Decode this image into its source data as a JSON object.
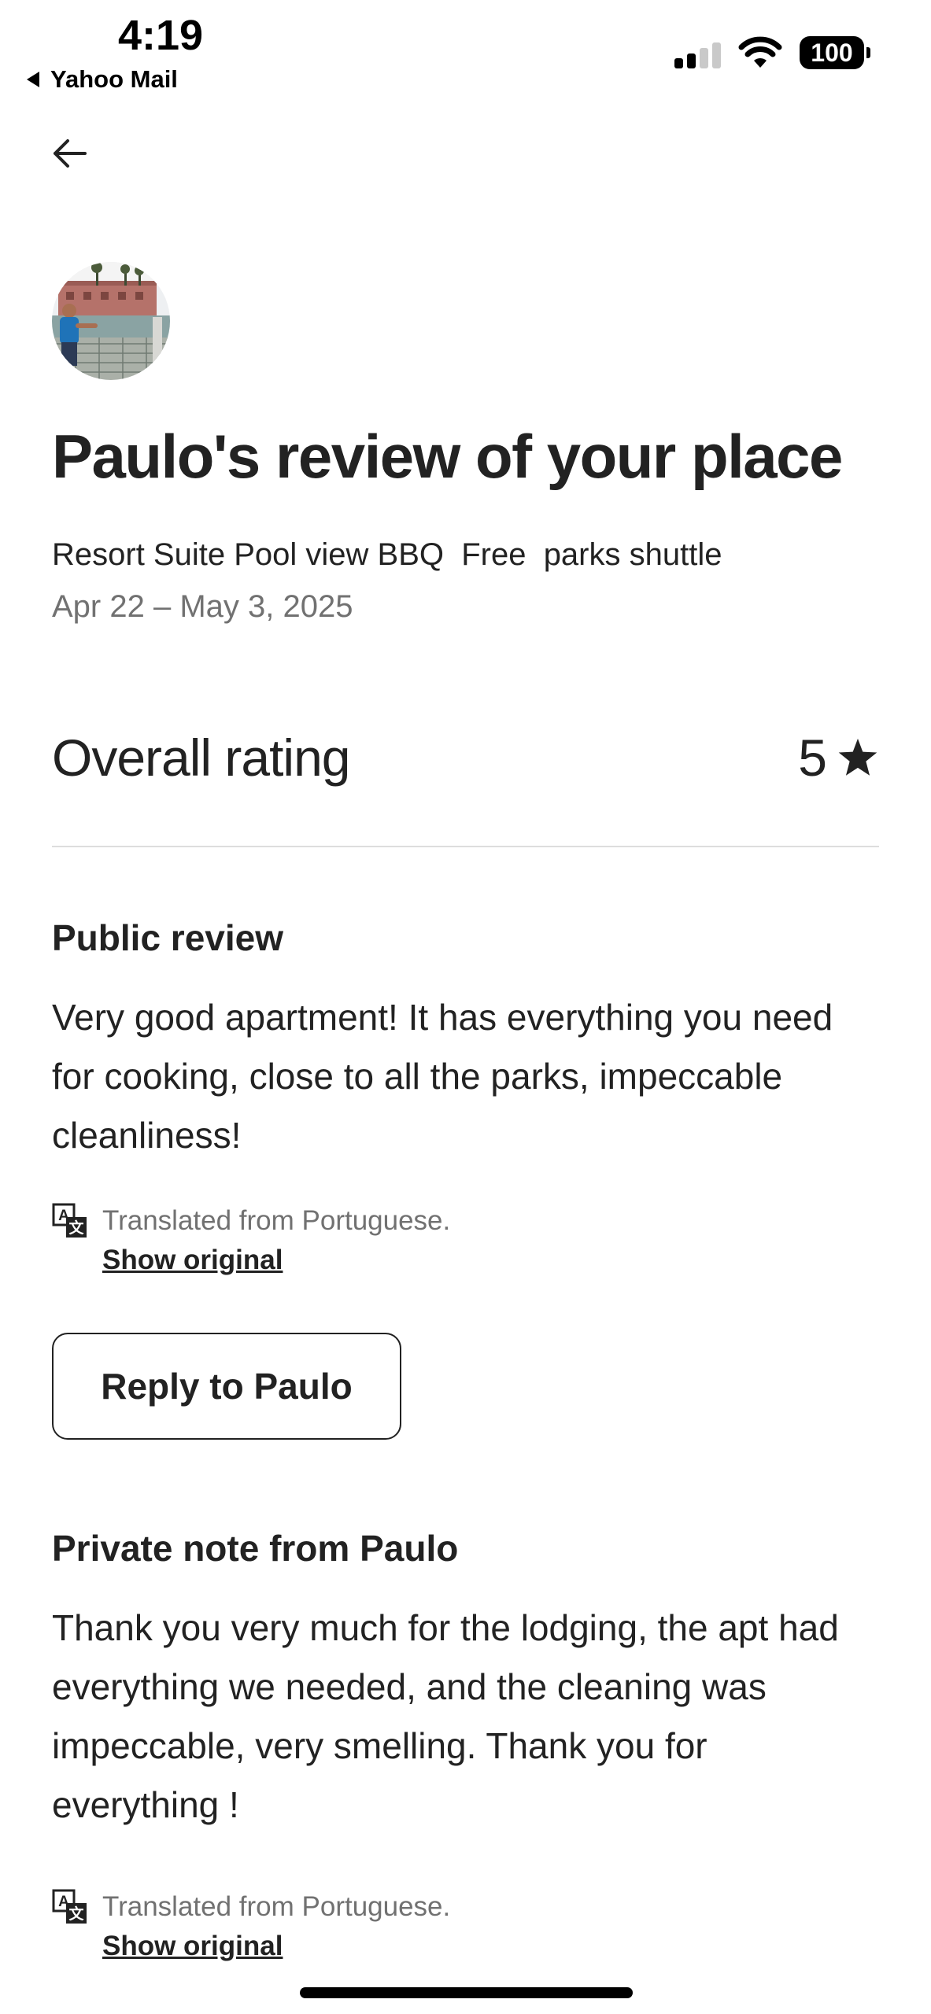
{
  "status_bar": {
    "time": "4:19",
    "back_app": "Yahoo Mail",
    "battery": "100"
  },
  "header": {
    "title": "Paulo's review of your place",
    "listing_name": "Resort Suite Pool view BBQ  Free  parks shuttle",
    "dates": "Apr 22 – May 3, 2025"
  },
  "rating": {
    "label": "Overall rating",
    "value": "5",
    "icon": "star-icon"
  },
  "public_review": {
    "title": "Public review",
    "text": "Very good apartment! It has everything you need for cooking, close to all the parks, impeccable cleanliness!",
    "translated_note": "Translated from Portuguese.",
    "show_original": "Show original"
  },
  "reply_button": "Reply to Paulo",
  "private_note": {
    "title": "Private note from Paulo",
    "text": "Thank you very much for the lodging, the apt had everything we needed, and the cleaning was impeccable, very smelling. Thank you for everything !",
    "translated_note": "Translated from Portuguese.",
    "show_original": "Show original"
  },
  "colors": {
    "text_primary": "#222222",
    "text_secondary": "#717171",
    "divider": "#dddddd"
  }
}
